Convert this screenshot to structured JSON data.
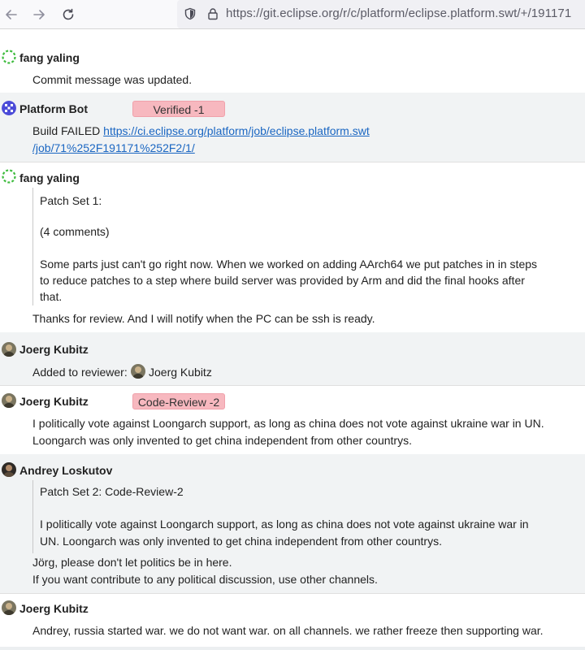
{
  "browser": {
    "url": "https://git.eclipse.org/r/c/platform/eclipse.platform.swt/+/191171"
  },
  "messages": [
    {
      "author": "fang yaling",
      "avatar": "green-identicon",
      "lines": [
        "Commit message was updated."
      ]
    },
    {
      "author": "Platform Bot",
      "avatar": "blue-identicon",
      "badge": "Verified -1",
      "build_prefix": "Build FAILED ",
      "link_line1": "https://ci.eclipse.org/platform/job/eclipse.platform.swt",
      "link_line2": "/job/71%252F191171%252F2/1/"
    },
    {
      "author": "fang yaling",
      "avatar": "green-identicon",
      "quote": [
        "Patch Set 1:",
        "(4 comments)",
        "Some parts just can't go right now. When we worked on adding AArch64 we put patches in in steps",
        "to reduce patches to a step where build server was provided by Arm and did the final hooks after",
        "that."
      ],
      "lines": [
        "Thanks for review. And I will notify when the PC can be ssh is ready."
      ]
    },
    {
      "author": "Joerg Kubitz",
      "avatar": "photo-avatar",
      "prefix": "Added to reviewer:",
      "reviewer": "Joerg Kubitz"
    },
    {
      "author": "Joerg Kubitz",
      "avatar": "photo-avatar",
      "badge": "Code-Review -2",
      "lines": [
        "I politically vote against Loongarch support, as long as china does not vote against ukraine war in UN.",
        "Loongarch was only invented to get china independent from other countrys."
      ]
    },
    {
      "author": "Andrey Loskutov",
      "avatar": "photo-avatar",
      "quote": [
        "Patch Set 2: Code-Review-2",
        "I politically vote against Loongarch support, as long as china does not vote against ukraine war in",
        "UN. Loongarch was only invented to get china independent from other countrys."
      ],
      "lines": [
        "Jörg, please don't let politics be in here.",
        "If you want contribute to any political discussion, use other channels."
      ]
    },
    {
      "author": "Joerg Kubitz",
      "avatar": "photo-avatar",
      "lines": [
        "Andrey, russia started war. we do not want war. on all channels. we rather freeze then supporting war."
      ]
    }
  ]
}
